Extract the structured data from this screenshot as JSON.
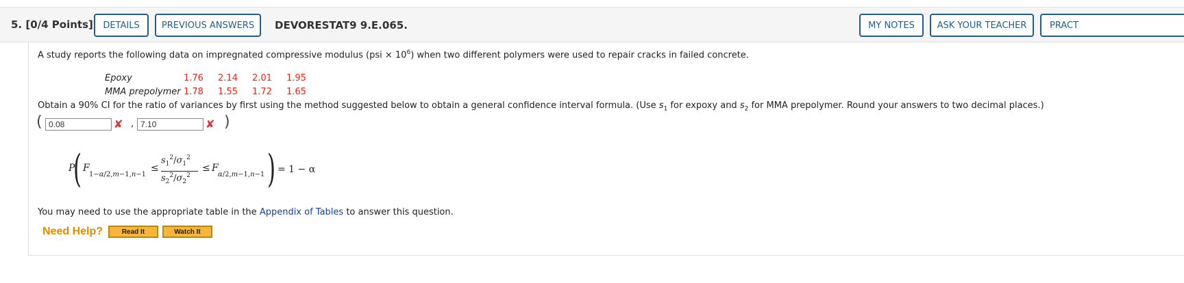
{
  "header": {
    "question_label": "5.  [0/4 Points]",
    "details_label": "DETAILS",
    "previous_answers_label": "PREVIOUS ANSWERS",
    "problem_code": "DEVORESTAT9 9.E.065.",
    "my_notes_label": "MY NOTES",
    "ask_teacher_label": "ASK YOUR TEACHER",
    "practice_label": "PRACT"
  },
  "problem": {
    "intro_pre": "A study reports the following data on impregnated compressive modulus (psi × 10",
    "intro_exp": "6",
    "intro_post": ") when two different polymers were used to repair cracks in failed concrete.",
    "rows": [
      {
        "label": "Epoxy",
        "values": [
          "1.76",
          "2.14",
          "2.01",
          "1.95"
        ]
      },
      {
        "label": "MMA prepolymer",
        "values": [
          "1.78",
          "1.55",
          "1.72",
          "1.65"
        ]
      }
    ],
    "instruction_1": "Obtain a 90% CI for the ratio of variances by first using the method suggested below to obtain a general confidence interval formula. (Use ",
    "instruction_s": "s",
    "instruction_sub1": "1",
    "instruction_2": " for expoxy and ",
    "instruction_sub2": "2",
    "instruction_3": " for MMA prepolymer. Round your answers to two decimal places.)",
    "answer_low": "0.08",
    "answer_high": "7.10",
    "formula_rhs": "= 1 − α",
    "appendix_pre": "You may need to use the appropriate table in the ",
    "appendix_link": "Appendix of Tables",
    "appendix_post": " to answer this question."
  },
  "help": {
    "need_help_label": "Need Help?",
    "read_it_label": "Read It",
    "watch_it_label": "Watch It"
  },
  "colors": {
    "accent": "#1f5e8c",
    "error": "#e8261b",
    "need_help": "#e68a00",
    "help_button": "#f7b53e"
  }
}
